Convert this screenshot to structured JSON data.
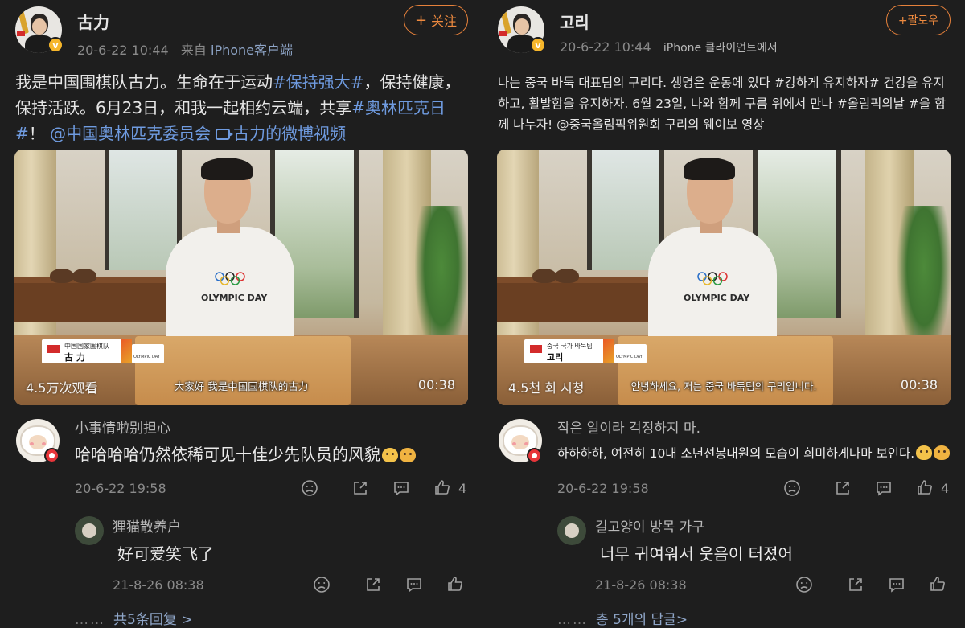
{
  "left": {
    "username": "古力",
    "follow_label": "关注",
    "meta_time": "20-6-22 10:44",
    "meta_prefix": "来自",
    "meta_source": "iPhone客户端",
    "post_text_1": "我是中国围棋队古力。生命在于运动",
    "post_tag_1": "#保持强大#",
    "post_text_2": "，保持健康，保持活跃。6月23日，和我一起相约云端，共享",
    "post_tag_2": "#奥林匹克日#",
    "post_text_3": "！",
    "post_mention": "@中国奥林匹克委员会",
    "post_video_link": "古力的微博视频",
    "video_views": "4.5万次观看",
    "video_duration": "00:38",
    "video_subtitle": "大家好 我是中国国棋队的古力",
    "video_lower_line1": "中国国家围棋队",
    "video_lower_line2": "古 力",
    "video_olympic_text": "OLYMPIC DAY",
    "comment_user": "小事情啦别担心",
    "comment_text": "哈哈哈哈仍然依稀可见十佳少先队员的风貌",
    "comment_time": "20-6-22 19:58",
    "comment_likes": "4",
    "reply_user": "狸猫散养户",
    "reply_text": "好可爱笑飞了",
    "reply_time": "21-8-26 08:38",
    "more_replies": "共5条回复 >",
    "more_dots": "……"
  },
  "right": {
    "username": "고리",
    "follow_label": "+팔로우",
    "meta_time": "20-6-22 10:44",
    "meta_source": "iPhone 클라이언트에서",
    "post_text": "나는 중국 바둑 대표팀의 구리다. 생명은 운동에 있다 #강하게 유지하자# 건강을 유지하고, 활발함을 유지하자. 6월 23일, 나와 함께 구름 위에서 만나 #올림픽의날 #을 함께 나누자! @중국올림픽위원회 구리의 웨이보 영상",
    "video_views": "4.5천 회 시청",
    "video_duration": "00:38",
    "video_subtitle": "안녕하세요, 저는 중국 바둑팀의 구리입니다.",
    "video_lower_line1": "중국 국가 바둑팀",
    "video_lower_line2": "고리",
    "video_olympic_text": "OLYMPIC DAY",
    "comment_user": "작은 일이라 걱정하지 마.",
    "comment_text": "하하하하, 여전히 10대 소년선봉대원의 모습이 희미하게나마 보인다.",
    "comment_time": "20-6-22 19:58",
    "comment_likes": "4",
    "reply_user": "길고양이 방목 가구",
    "reply_text": "너무 귀여워서 웃음이 터졌어",
    "reply_time": "21-8-26 08:38",
    "more_replies": "총 5개의 답글>",
    "more_dots": "……"
  },
  "colors": {
    "accent_orange": "#ee8a3f",
    "link_blue": "#6f9be0",
    "background": "#1e1e1e"
  },
  "icons": [
    "verified-badge-icon",
    "video-link-icon",
    "dislike-icon",
    "share-icon",
    "comment-icon",
    "like-icon"
  ]
}
